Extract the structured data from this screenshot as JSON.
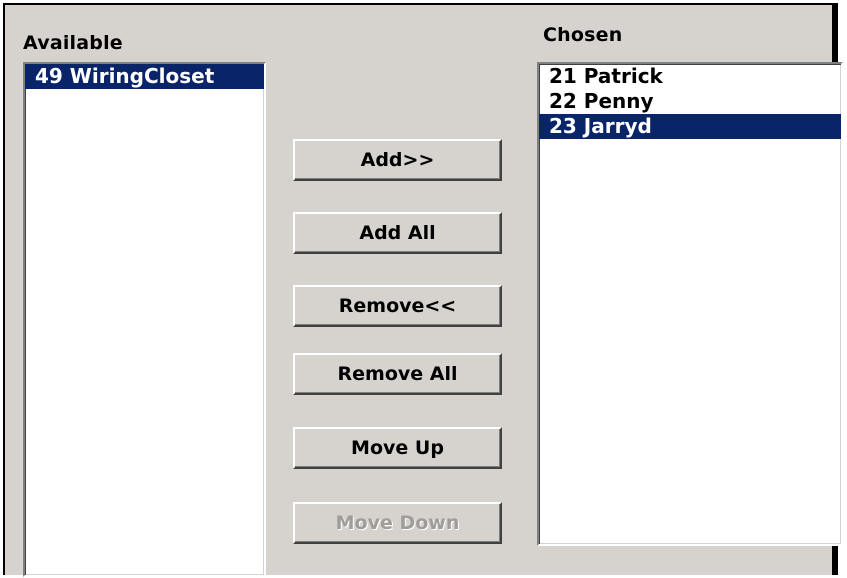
{
  "available": {
    "label": "Available",
    "items": [
      {
        "text": "49 WiringCloset",
        "selected": true
      }
    ]
  },
  "chosen": {
    "label": "Chosen",
    "items": [
      {
        "text": "21 Patrick",
        "selected": false
      },
      {
        "text": "22 Penny",
        "selected": false
      },
      {
        "text": "23 Jarryd",
        "selected": true
      }
    ]
  },
  "buttons": {
    "add": "Add>>",
    "add_all": "Add All",
    "remove": "Remove<<",
    "remove_all": "Remove All",
    "move_up": "Move Up",
    "move_down": "Move Down"
  },
  "colors": {
    "selection": "#0a246a",
    "dialog_bg": "#d6d3ce"
  }
}
